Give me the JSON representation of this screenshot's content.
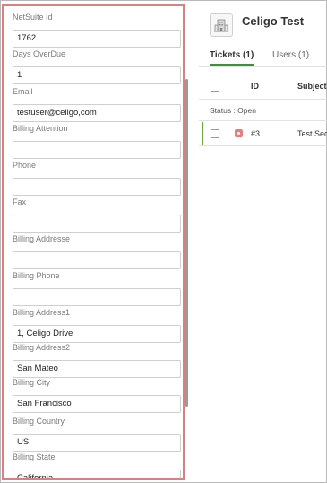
{
  "form": {
    "fields": [
      {
        "label": "NetSuite Id",
        "value": "1762"
      },
      {
        "label": "Days OverDue",
        "value": "1"
      },
      {
        "label": "Email",
        "value": "testuser@celigo,com"
      },
      {
        "label": "Billing Attention",
        "value": ""
      },
      {
        "label": "Phone",
        "value": ""
      },
      {
        "label": "Fax",
        "value": ""
      },
      {
        "label": "Billing Addresse",
        "value": ""
      },
      {
        "label": "Billing Phone",
        "value": ""
      },
      {
        "label": "Billing Address1",
        "value": "1, Celigo Drive"
      },
      {
        "label": "Billing Address2",
        "value": "San Mateo"
      },
      {
        "label": "Billing City",
        "value": "San Francisco"
      },
      {
        "label": "Billing Country",
        "value": "US"
      },
      {
        "label": "Billing State",
        "value": "California"
      }
    ]
  },
  "org": {
    "name": "Celigo Test",
    "logo_icon": "building-icon"
  },
  "tabs": [
    {
      "label": "Tickets (1)",
      "active": true
    },
    {
      "label": "Users (1)",
      "active": false
    }
  ],
  "table": {
    "headers": {
      "id": "ID",
      "subject": "Subject"
    },
    "group_label": "Status : Open",
    "rows": [
      {
        "id": "#3",
        "subject": "Test Sec",
        "priority_color": "#e67e7e"
      }
    ]
  },
  "colors": {
    "panel_border": "#d98080",
    "active_tab": "#3c8f3c",
    "row_accent": "#6aae3a"
  }
}
